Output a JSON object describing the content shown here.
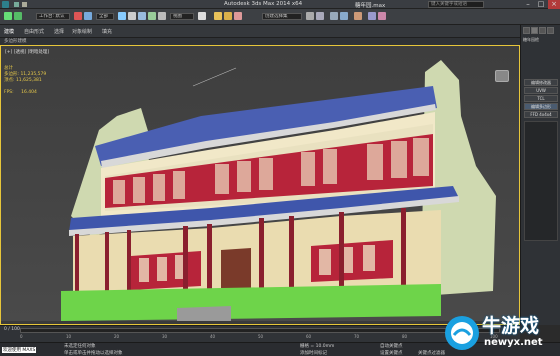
{
  "window": {
    "title": "Autodesk 3ds Max  2014 x64",
    "file": "糖年园.max",
    "search_placeholder": "键入关键字或短语"
  },
  "toolbar": {
    "workspace_value": "工作台: 默认",
    "selection_filter": "全部",
    "view_dropdown": "视图",
    "named_selection": "创建选择集"
  },
  "ribbon": {
    "tabs": [
      "建模",
      "自由形式",
      "选择",
      "对象绘制",
      "填充"
    ],
    "sub_label": "多边形建模"
  },
  "viewport": {
    "label": "[+] [透视] [明暗处理]",
    "stats": [
      "总计",
      "多边形: 11,235,579",
      "顶点: 11,625,381"
    ],
    "fps_label": "FPS:",
    "fps_value": "16.404"
  },
  "command_panel": {
    "header": "糖年园檐",
    "items": [
      "编辑修改器",
      "UVW",
      "TCL",
      "编辑多边形",
      "FFD 4x4x4"
    ]
  },
  "timeline": {
    "position": "0 / 100",
    "ticks": [
      "0",
      "10",
      "20",
      "30",
      "40",
      "50",
      "60",
      "70",
      "80",
      "90",
      "100"
    ]
  },
  "statusbar": {
    "selection": "未选定任何对象",
    "prompt": "单击或单击并拖动以选择对象",
    "maxscript": "欢迎使用 MAXS",
    "add_time_tag": "添加时间标记",
    "grid": "栅格 = 10.0mm",
    "auto_key": "自动关键点",
    "set_key": "设置关键点",
    "filter": "关键点过滤器"
  },
  "watermark": {
    "brand": "牛游戏",
    "url": "newyx.net"
  }
}
